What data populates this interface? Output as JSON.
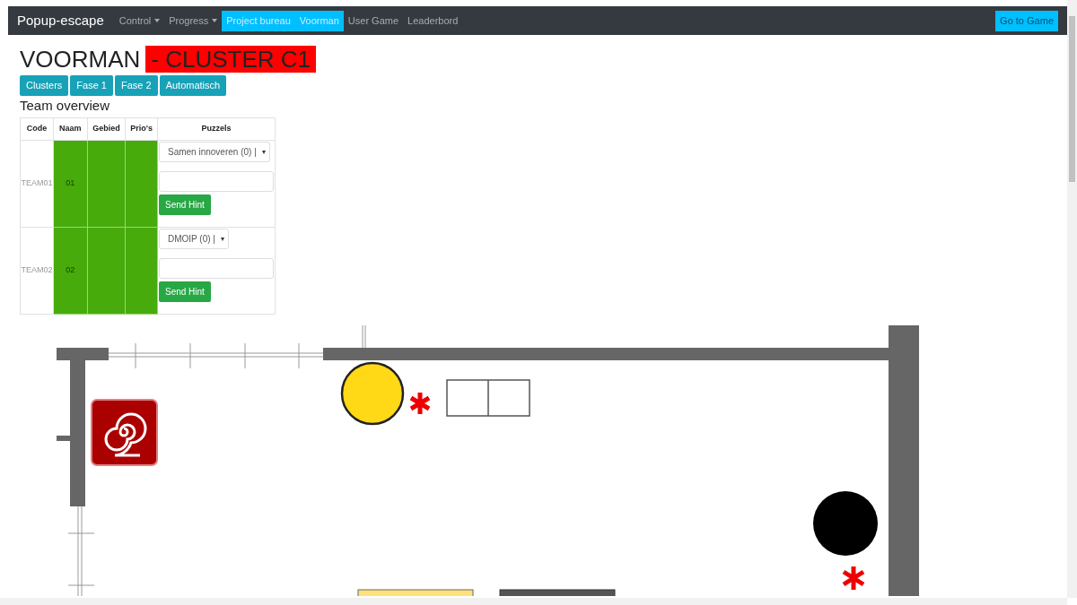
{
  "navbar": {
    "brand": "Popup-escape",
    "items": [
      {
        "label": "Control",
        "kind": "dropdown",
        "selected": false
      },
      {
        "label": "Progress",
        "kind": "dropdown",
        "selected": false
      },
      {
        "label": "Project bureau",
        "kind": "link",
        "selected": true
      },
      {
        "label": "Voorman",
        "kind": "link",
        "selected": true
      },
      {
        "label": "User Game",
        "kind": "link",
        "selected": false
      },
      {
        "label": "Leaderbord",
        "kind": "link",
        "selected": false
      }
    ],
    "action": "Go to Game"
  },
  "heading": {
    "title": "VOORMAN",
    "cluster": "- CLUSTER C1"
  },
  "phase_buttons": [
    "Clusters",
    "Fase 1",
    "Fase 2",
    "Automatisch"
  ],
  "team_overview": {
    "title": "Team overview",
    "columns": [
      "Code",
      "Naam",
      "Gebied",
      "Prio's",
      "Puzzels"
    ],
    "rows": [
      {
        "code": "TEAM01",
        "naam": "01",
        "color": "#47ab0b",
        "puzzle": "Samen innoveren (0) |",
        "hint_button": "Send Hint"
      },
      {
        "code": "TEAM02",
        "naam": "02",
        "color": "#47ab0b",
        "puzzle": "DMOIP (0) |",
        "hint_button": "Send Hint"
      }
    ]
  }
}
